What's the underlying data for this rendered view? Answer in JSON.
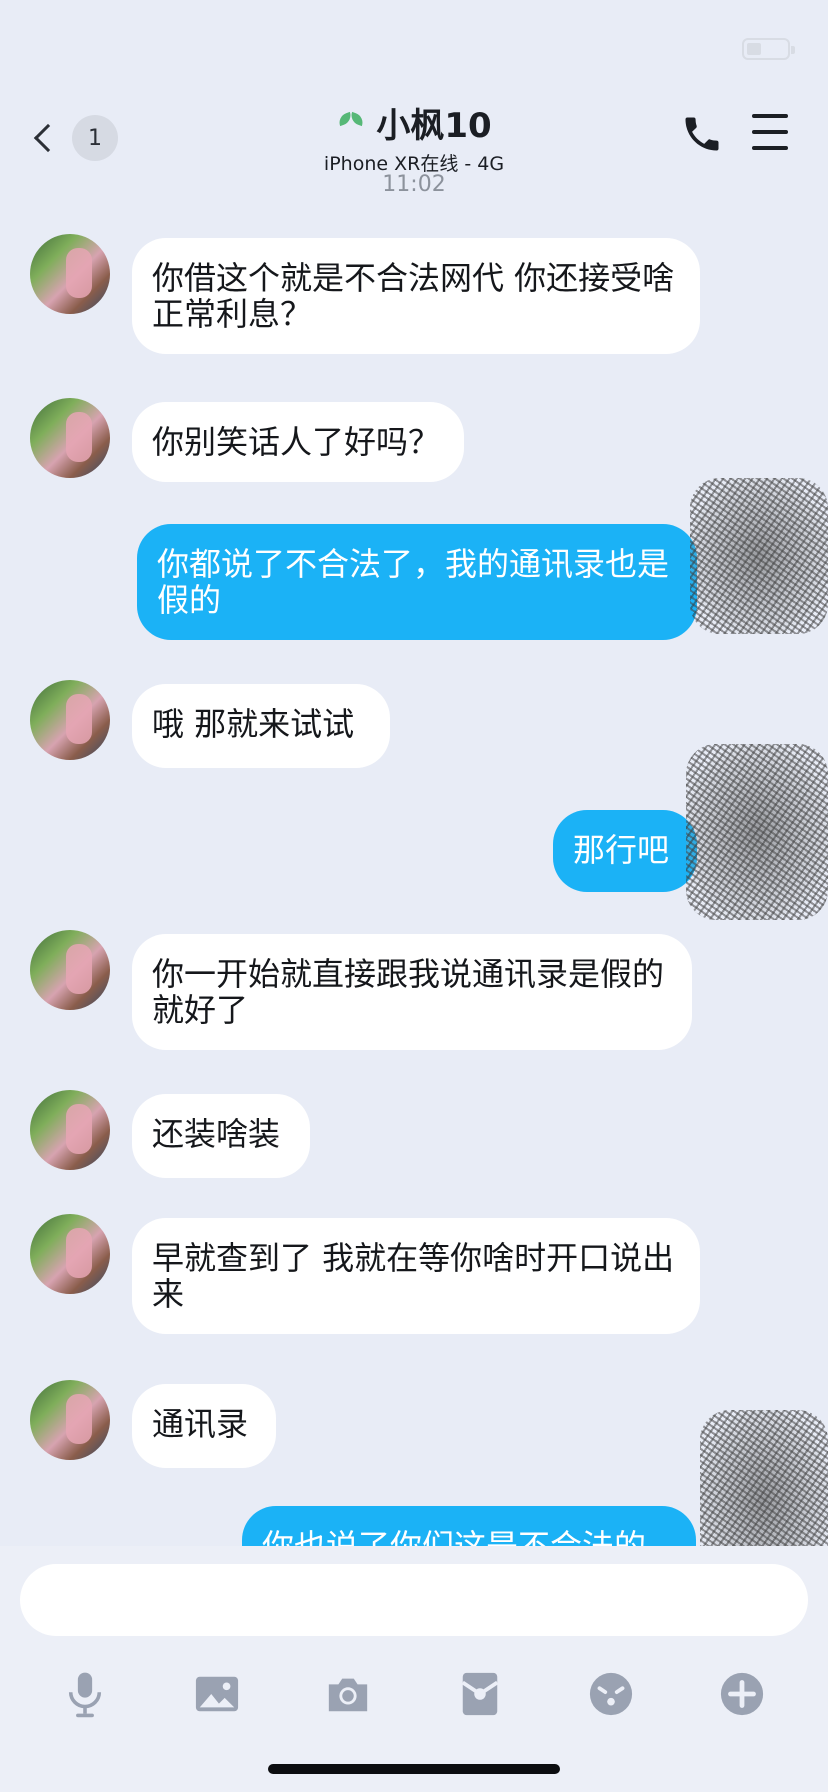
{
  "status": {
    "battery_level": 0.35
  },
  "header": {
    "back_badge": "1",
    "contact_name": "小枫10",
    "contact_status": "iPhone XR在线 - 4G"
  },
  "timestamp": "11:02",
  "messages": [
    {
      "side": "in",
      "text": "你借这个就是不合法网代 你还接受啥正常利息？"
    },
    {
      "side": "in",
      "text": "你别笑话人了好吗？"
    },
    {
      "side": "out",
      "text": "你都说了不合法了，我的通讯录也是假的"
    },
    {
      "side": "in",
      "text": "哦 那就来试试"
    },
    {
      "side": "out",
      "text": "那行吧"
    },
    {
      "side": "in",
      "text": "你一开始就直接跟我说通讯录是假的就好了"
    },
    {
      "side": "in",
      "text": "还装啥装"
    },
    {
      "side": "in",
      "text": "早就查到了 我就在等你啥时开口说出来"
    },
    {
      "side": "in",
      "text": "通讯录"
    },
    {
      "side": "out",
      "text": "你也说了你们这是不合法的"
    }
  ],
  "input": {
    "placeholder": "",
    "value": ""
  },
  "toolbar": {
    "items": [
      "microphone-icon",
      "image-icon",
      "camera-icon",
      "red-packet-icon",
      "emoji-icon",
      "plus-icon"
    ]
  },
  "colors": {
    "outgoing_bubble": "#1bb2f6",
    "incoming_bubble": "#ffffff",
    "background": "#e8ecf6"
  }
}
